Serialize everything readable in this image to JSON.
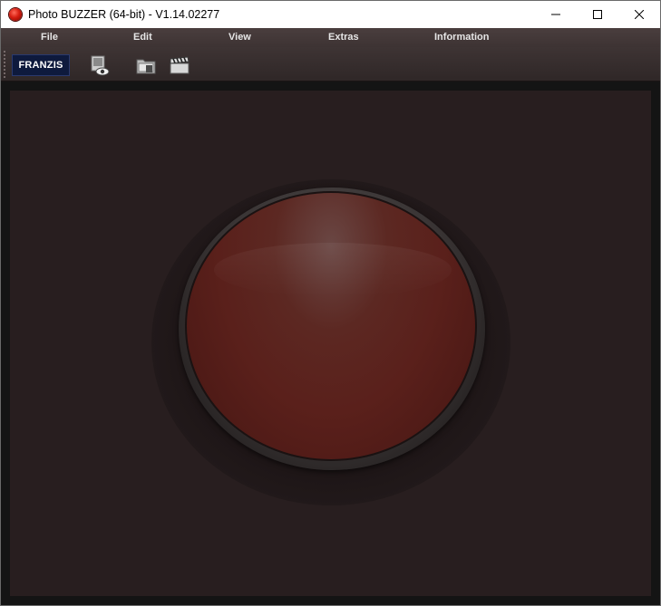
{
  "window": {
    "title": "Photo BUZZER (64-bit) - V1.14.02277",
    "controls": {
      "minimize_icon": "minimize-icon",
      "maximize_icon": "maximize-icon",
      "close_icon": "close-icon"
    }
  },
  "menu": {
    "items": [
      {
        "label": "File"
      },
      {
        "label": "Edit"
      },
      {
        "label": "View"
      },
      {
        "label": "Extras"
      },
      {
        "label": "Information"
      }
    ]
  },
  "toolbar": {
    "logo_label": "FRANZIS",
    "buttons": [
      {
        "icon": "preview-icon"
      },
      {
        "icon": "open-folder-icon"
      },
      {
        "icon": "clapperboard-icon"
      }
    ]
  },
  "colors": {
    "menu_bg": "#3d3333",
    "canvas_bg": "#281e1f",
    "buzzer_red": "#5a201b",
    "logo_bg": "#0e1a3d"
  }
}
